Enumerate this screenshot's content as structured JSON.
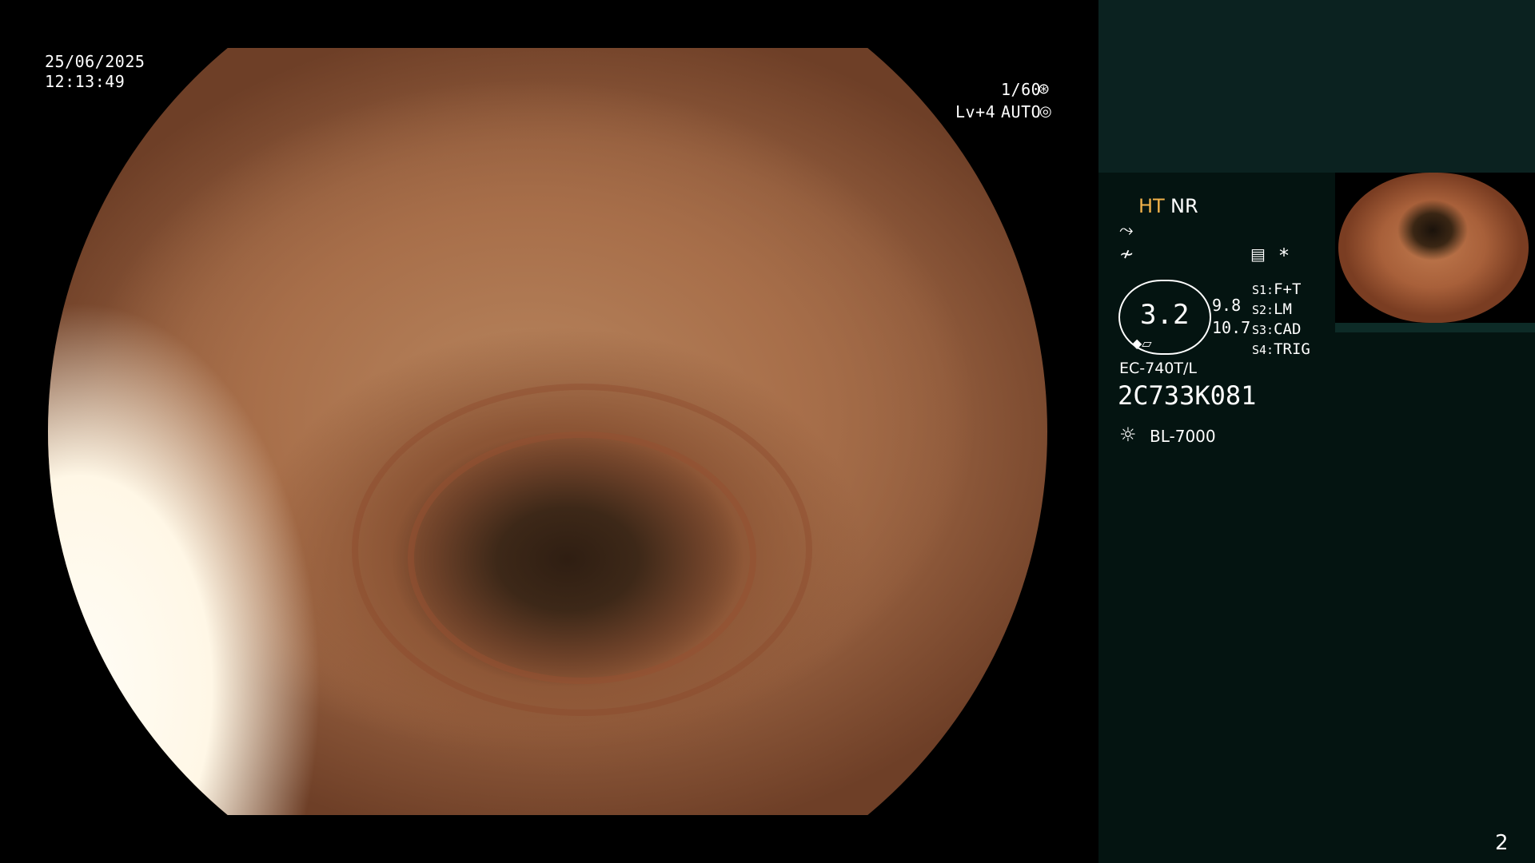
{
  "overlay": {
    "date": "25/06/2025",
    "time": "12:13:49",
    "shutter": "1/60",
    "level": "Lv+4",
    "exposure_mode": "AUTO",
    "shutter_icon": "shutter-icon",
    "auto_icon": "iris-icon"
  },
  "panel": {
    "mode_ht": "HT",
    "mode_nr": "NR",
    "icon_structure": "structure-enhance-icon",
    "icon_color": "color-enhance-icon",
    "icon_menu": "settings-list-icon",
    "star": "*",
    "scope_value": "3.2",
    "value_a": "9.8",
    "value_b": "10.7",
    "switches": [
      {
        "key": "S1:",
        "value": "F+T"
      },
      {
        "key": "S2:",
        "value": "LM"
      },
      {
        "key": "S3:",
        "value": "CAD"
      },
      {
        "key": "S4:",
        "value": "TRIG"
      }
    ],
    "scope_model": "EC-740T/L",
    "serial": "2C733K081",
    "light_source": "BL-7000",
    "light_icon": "light-source-icon",
    "page_number": "2"
  },
  "colors": {
    "panel_bg": "#041411",
    "panel_top_bg": "#0b2220",
    "accent_yellow": "#f2b24a"
  }
}
